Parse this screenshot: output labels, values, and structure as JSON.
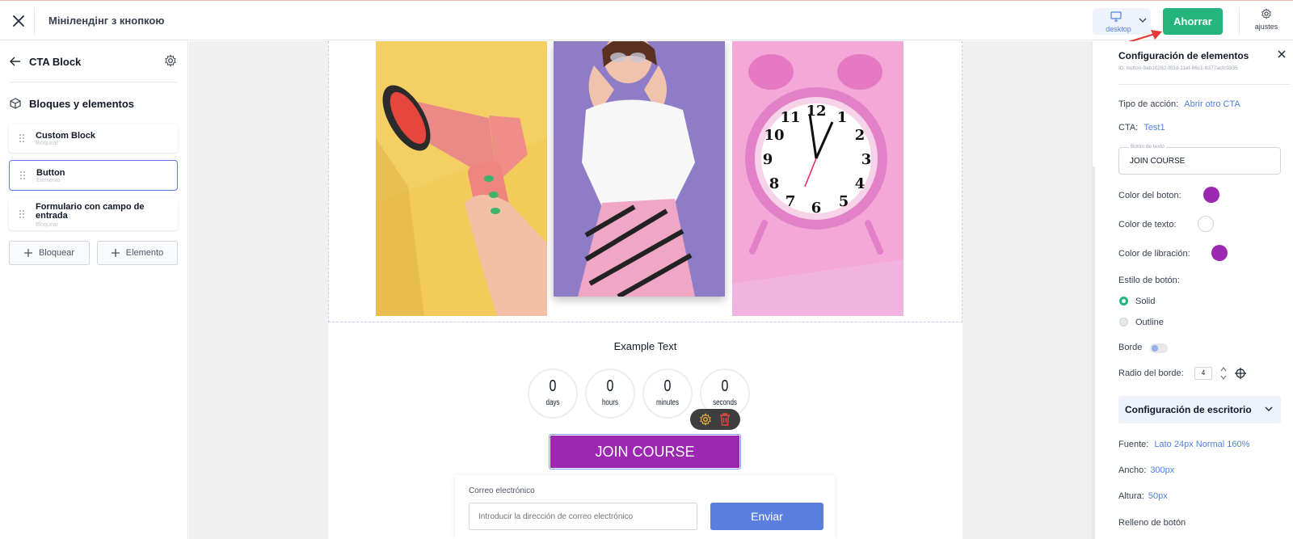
{
  "header": {
    "title": "Мінілендінг з кнопкою",
    "device_label": "desktop",
    "save_label": "Ahorrar",
    "settings_label": "ajustes"
  },
  "left_sidebar": {
    "title": "CTA Block",
    "section_title": "Bloques y elementos",
    "items": [
      {
        "name": "Custom Block",
        "type": "Bloquear"
      },
      {
        "name": "Button",
        "type": "Elemento"
      },
      {
        "name": "Formulario con campo de entrada",
        "type": "Bloquear"
      }
    ],
    "add_block_label": "Bloquear",
    "add_element_label": "Elemento"
  },
  "canvas": {
    "countdown_title": "Example Text",
    "countdown": [
      {
        "value": "0",
        "unit": "days"
      },
      {
        "value": "0",
        "unit": "hours"
      },
      {
        "value": "0",
        "unit": "minutes"
      },
      {
        "value": "0",
        "unit": "seconds"
      }
    ],
    "cta_text": "JOIN COURSE",
    "cta_color": "#9c27b0",
    "form": {
      "label": "Correo electrónico",
      "placeholder": "Introducir la dirección de correo electrónico",
      "submit_label": "Enviar"
    }
  },
  "right_panel": {
    "title": "Configuración de elementos",
    "element_id": "ID: button-9ab10282-f83d-11ef-86c1-8377acfc9335",
    "action_type_label": "Tipo de acción:",
    "action_type_value": "Abrir otro CTA",
    "cta_label": "CTA:",
    "cta_value": "Test1",
    "text_field_label": "Botón de texto",
    "text_field_value": "JOIN COURSE",
    "button_color_label": "Color del boton:",
    "button_color": "#9c27b0",
    "text_color_label": "Color de texto:",
    "text_color": "#ffffff",
    "hover_color_label": "Color de libración:",
    "hover_color": "#9c27b0",
    "button_style_label": "Estilo de botón:",
    "style_options": [
      "Solid",
      "Outline"
    ],
    "style_selected": "Solid",
    "border_label": "Borde",
    "border_radius_label": "Radio del borde:",
    "border_radius_value": "4",
    "desktop_section_label": "Configuración de escritorio",
    "font_label": "Fuente:",
    "font_value": "Lato 24px Normal 160%",
    "width_label": "Ancho:",
    "width_value": "300px",
    "height_label": "Altura:",
    "height_value": "50px",
    "padding_label": "Relleno de botón"
  },
  "colors": {
    "accent": "#5b7fe0",
    "save_green": "#24b47e"
  }
}
